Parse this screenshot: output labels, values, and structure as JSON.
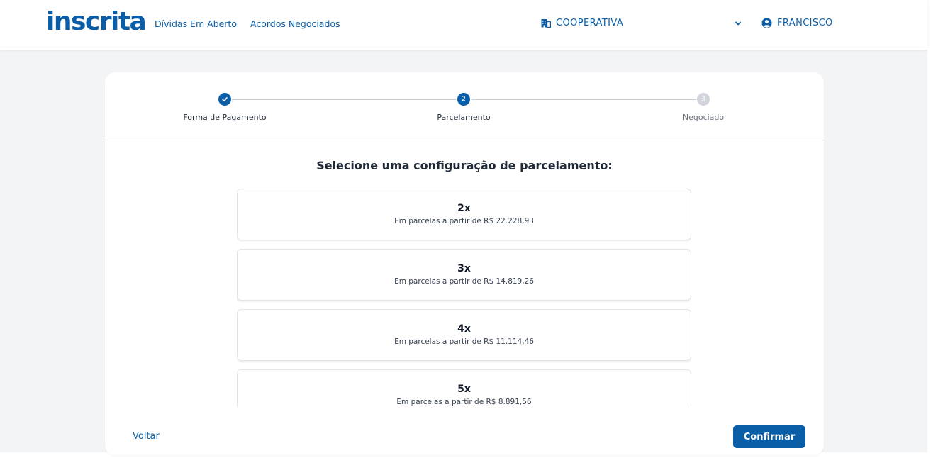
{
  "header": {
    "logo": "inscrita",
    "nav": [
      {
        "label": "Dívidas Em Aberto"
      },
      {
        "label": "Acordos Negociados"
      }
    ],
    "organization": "COOPERATIVA",
    "user": "FRANCISCO"
  },
  "stepper": {
    "steps": [
      {
        "label": "Forma de Pagamento",
        "state": "done"
      },
      {
        "label": "Parcelamento",
        "number": "2",
        "state": "active"
      },
      {
        "label": "Negociado",
        "number": "3",
        "state": "pending"
      }
    ]
  },
  "main": {
    "heading": "Selecione uma configuração de parcelamento:",
    "options": [
      {
        "installments": "2x",
        "description": "Em parcelas a partir de R$ 22.228,93"
      },
      {
        "installments": "3x",
        "description": "Em parcelas a partir de R$ 14.819,26"
      },
      {
        "installments": "4x",
        "description": "Em parcelas a partir de R$ 11.114,46"
      },
      {
        "installments": "5x",
        "description": "Em parcelas a partir de R$ 8.891,56"
      }
    ]
  },
  "footer": {
    "back_label": "Voltar",
    "confirm_label": "Confirmar"
  },
  "colors": {
    "brand": "#0a5ea8",
    "background": "#f3f4f6",
    "pending": "#d1d5db"
  }
}
